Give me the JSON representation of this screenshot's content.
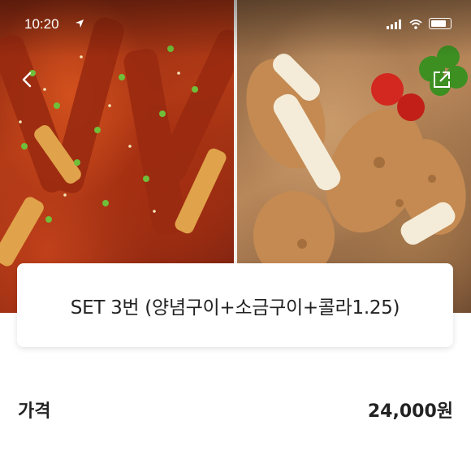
{
  "status_bar": {
    "time": "10:20",
    "location_icon": "location-arrow-icon",
    "signal_icon": "signal-icon",
    "wifi_icon": "wifi-icon",
    "battery_icon": "battery-icon"
  },
  "header": {
    "back_icon": "back-arrow-icon",
    "share_icon": "share-icon"
  },
  "menu": {
    "title": "SET 3번 (양념구이+소금구이+콜라1.25)"
  },
  "price": {
    "label": "가격",
    "value": "24,000원"
  }
}
